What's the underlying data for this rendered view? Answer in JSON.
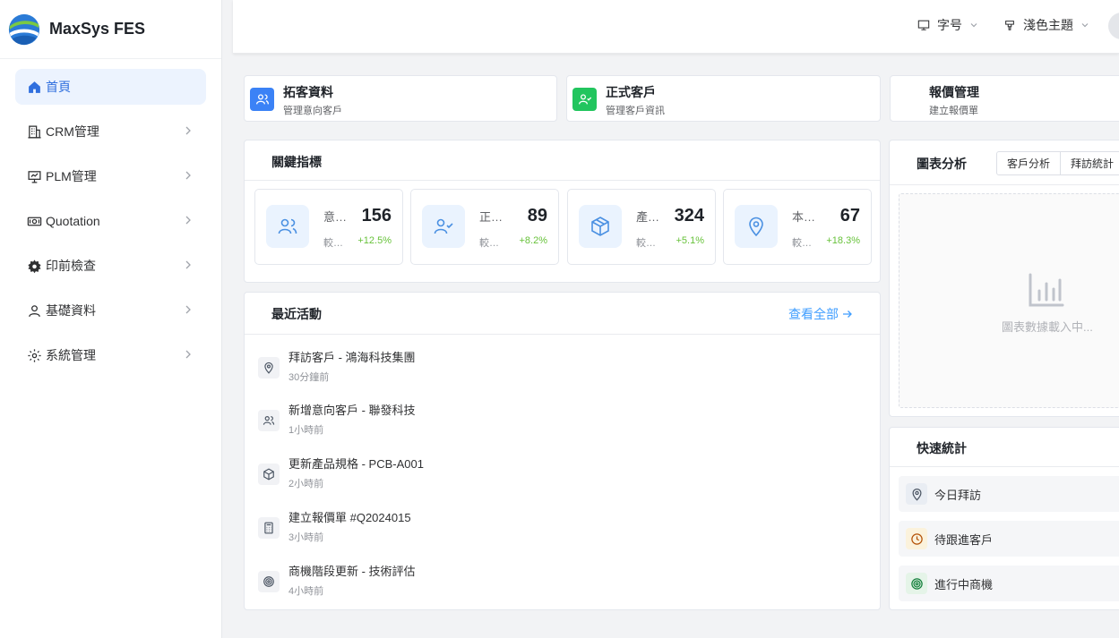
{
  "brand": {
    "name": "MaxSys FES"
  },
  "sidebar": {
    "items": [
      {
        "label": "首頁",
        "icon": "home-icon",
        "active": true
      },
      {
        "label": "CRM管理",
        "icon": "building-icon"
      },
      {
        "label": "PLM管理",
        "icon": "presentation-icon"
      },
      {
        "label": "Quotation",
        "icon": "money-icon"
      },
      {
        "label": "印前檢查",
        "icon": "gear-icon"
      },
      {
        "label": "基礎資料",
        "icon": "user-icon"
      },
      {
        "label": "系統管理",
        "icon": "settings-icon"
      }
    ]
  },
  "header": {
    "font_size_label": "字号",
    "theme_label": "淺色主題"
  },
  "quick_cards": [
    {
      "title": "拓客資料",
      "subtitle": "管理意向客戶",
      "icon": "users-icon",
      "color": "#3b82f6"
    },
    {
      "title": "正式客戶",
      "subtitle": "管理客戶資訊",
      "icon": "user-check-icon",
      "color": "#22c55e"
    },
    {
      "title": "報價管理",
      "subtitle": "建立報價單",
      "icon": "",
      "color": ""
    }
  ],
  "kpi": {
    "title": "關鍵指標",
    "cards": [
      {
        "label": "意向客戶",
        "value": "156",
        "sub": "較上月",
        "delta": "+12.5%",
        "icon": "users-icon"
      },
      {
        "label": "正式客戶",
        "value": "89",
        "sub": "較上月",
        "delta": "+8.2%",
        "icon": "user-check-icon"
      },
      {
        "label": "產品規格",
        "value": "324",
        "sub": "較上月",
        "delta": "+5.1%",
        "icon": "box-icon"
      },
      {
        "label": "本月拜訪",
        "value": "67",
        "sub": "較上月",
        "delta": "+18.3%",
        "icon": "map-pin-icon"
      }
    ]
  },
  "activities": {
    "title": "最近活動",
    "view_all": "查看全部",
    "items": [
      {
        "title": "拜訪客戶 - 鴻海科技集團",
        "time": "30分鐘前",
        "icon": "map-pin-icon"
      },
      {
        "title": "新增意向客戶 - 聯發科技",
        "time": "1小時前",
        "icon": "users-icon"
      },
      {
        "title": "更新產品規格 - PCB-A001",
        "time": "2小時前",
        "icon": "box-icon"
      },
      {
        "title": "建立報價單 #Q2024015",
        "time": "3小時前",
        "icon": "calculator-icon"
      },
      {
        "title": "商機階段更新 - 技術評估",
        "time": "4小時前",
        "icon": "target-icon"
      }
    ]
  },
  "chart_panel": {
    "title": "圖表分析",
    "tabs": [
      "客戶分析",
      "拜訪統計"
    ],
    "placeholder": "圖表數據載入中..."
  },
  "quick_stats": {
    "title": "快速統計",
    "items": [
      {
        "label": "今日拜訪",
        "icon": "map-pin-icon",
        "color": "#4b5563"
      },
      {
        "label": "待跟進客戶",
        "icon": "clock-icon",
        "color": "#b45309"
      },
      {
        "label": "進行中商機",
        "icon": "target-icon",
        "color": "#15803d"
      }
    ]
  }
}
